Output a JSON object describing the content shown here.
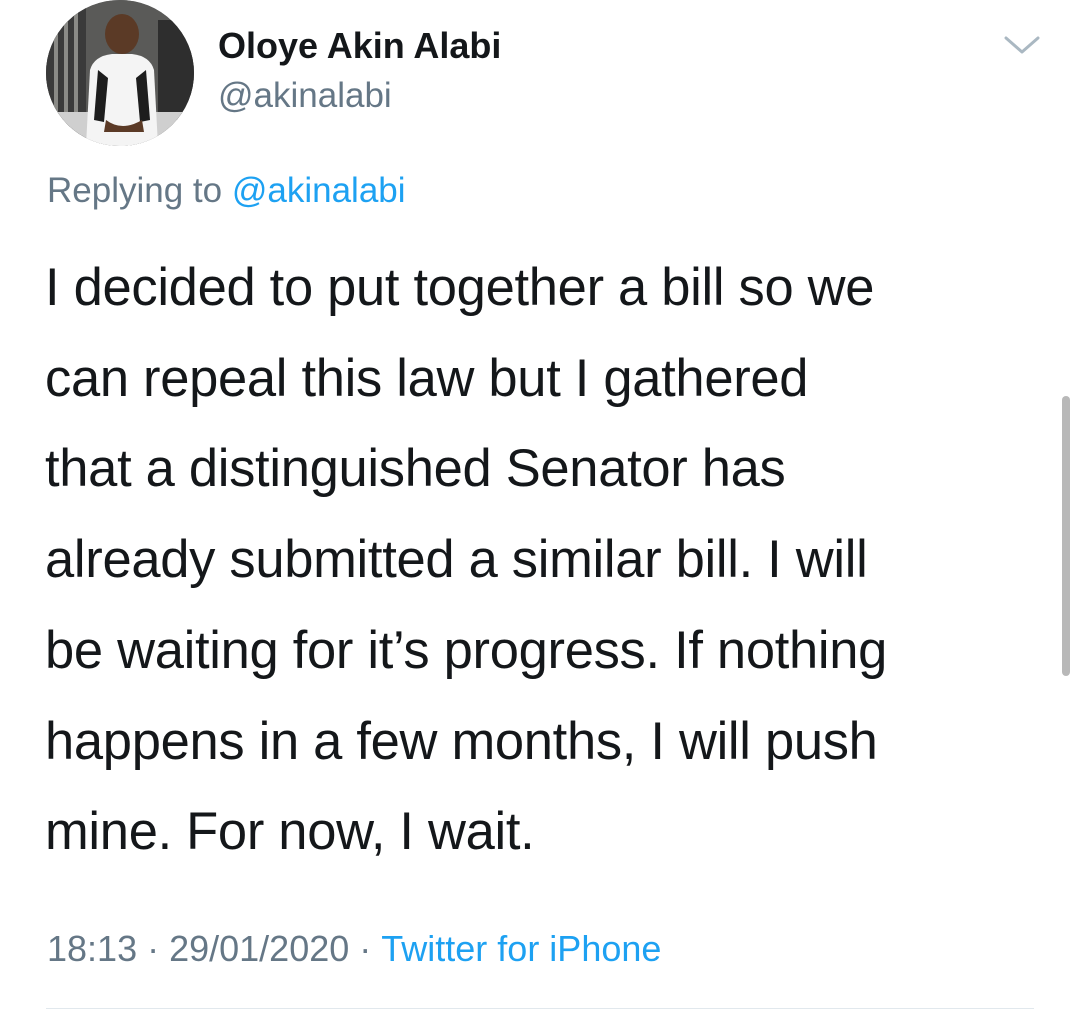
{
  "tweet": {
    "author": {
      "display_name": "Oloye Akin Alabi",
      "handle": "@akinalabi"
    },
    "reply": {
      "prefix": "Replying to",
      "mention": "@akinalabi"
    },
    "text_lines": [
      "I decided to put together a bill so we",
      "can repeal this law but I gathered",
      "that a distinguished Senator has",
      "already submitted a similar bill. I will",
      "be waiting for it’s progress. If nothing",
      "happens in a few months, I will push",
      "mine. For now, I wait."
    ],
    "meta": {
      "time": "18:13",
      "date": "29/01/2020",
      "separator": "·",
      "source": "Twitter for iPhone"
    }
  },
  "icons": {
    "menu": "chevron-down-icon"
  },
  "colors": {
    "text": "#14171a",
    "secondary": "#657786",
    "link": "#1da1f2"
  }
}
